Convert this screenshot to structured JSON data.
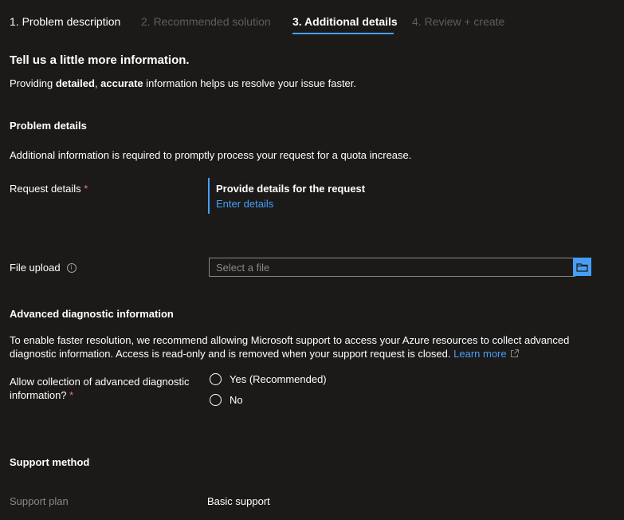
{
  "wizard": {
    "tabs": [
      {
        "label": "1. Problem description",
        "state": "done"
      },
      {
        "label": "2. Recommended solution",
        "state": "disabled"
      },
      {
        "label": "3. Additional details",
        "state": "active"
      },
      {
        "label": "4. Review + create",
        "state": "disabled"
      }
    ]
  },
  "intro": {
    "heading": "Tell us a little more information.",
    "text_prefix": "Providing ",
    "bold_1": "detailed",
    "comma": ", ",
    "bold_2": "accurate",
    "text_suffix": " information helps us resolve your issue faster."
  },
  "problem_details": {
    "heading": "Problem details",
    "description": "Additional information is required to promptly process your request for a quota increase.",
    "request_details_label": "Request details",
    "required_marker": "*",
    "request_title": "Provide details for the request",
    "enter_details_link": "Enter details",
    "file_upload_label": "File upload",
    "info_icon_glyph": "i",
    "file_placeholder": "Select a file"
  },
  "advanced_diagnostic": {
    "heading": "Advanced diagnostic information",
    "line1": "To enable faster resolution, we recommend allowing Microsoft support to access your Azure resources to collect advanced",
    "line2": "diagnostic information. Access is read-only and is removed when your support request is closed.",
    "learn_more": "Learn more",
    "allow_label_line1": "Allow collection of advanced diagnostic",
    "allow_label_line2": "information?",
    "required_marker": "*",
    "options": [
      "Yes (Recommended)",
      "No"
    ]
  },
  "support_method": {
    "heading": "Support method",
    "plan_label": "Support plan",
    "plan_value": "Basic support"
  },
  "colors": {
    "background": "#1b1a19",
    "accent": "#479ef5",
    "required": "#f1707b",
    "muted": "#8a8886",
    "disabled_tab": "#5f5e5c"
  },
  "icons": {
    "info": "info-icon",
    "folder": "folder-icon",
    "external_link": "external-link-icon"
  }
}
